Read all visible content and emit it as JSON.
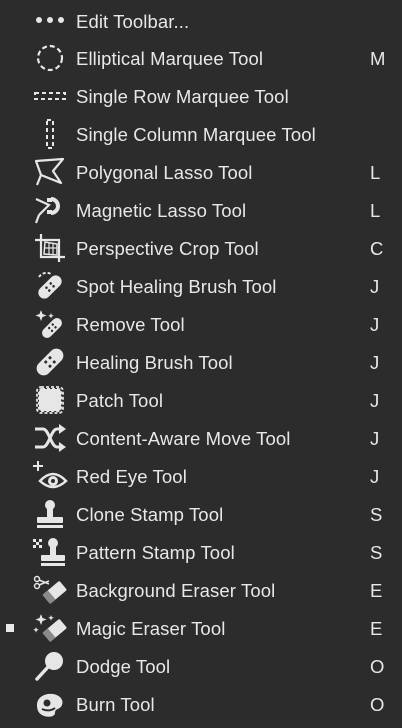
{
  "menu": {
    "items": [
      {
        "label": "Edit Toolbar...",
        "shortcut": "",
        "icon": "more-dots-icon",
        "selected": false
      },
      {
        "label": "Elliptical Marquee Tool",
        "shortcut": "M",
        "icon": "elliptical-marquee-icon",
        "selected": false
      },
      {
        "label": "Single Row Marquee Tool",
        "shortcut": "",
        "icon": "single-row-marquee-icon",
        "selected": false
      },
      {
        "label": "Single Column Marquee Tool",
        "shortcut": "",
        "icon": "single-column-marquee-icon",
        "selected": false
      },
      {
        "label": "Polygonal Lasso Tool",
        "shortcut": "L",
        "icon": "polygonal-lasso-icon",
        "selected": false
      },
      {
        "label": "Magnetic Lasso Tool",
        "shortcut": "L",
        "icon": "magnetic-lasso-icon",
        "selected": false
      },
      {
        "label": "Perspective Crop Tool",
        "shortcut": "C",
        "icon": "perspective-crop-icon",
        "selected": false
      },
      {
        "label": "Spot Healing Brush Tool",
        "shortcut": "J",
        "icon": "spot-healing-brush-icon",
        "selected": false
      },
      {
        "label": "Remove Tool",
        "shortcut": "J",
        "icon": "remove-tool-icon",
        "selected": false
      },
      {
        "label": "Healing Brush Tool",
        "shortcut": "J",
        "icon": "healing-brush-icon",
        "selected": false
      },
      {
        "label": "Patch Tool",
        "shortcut": "J",
        "icon": "patch-tool-icon",
        "selected": false
      },
      {
        "label": "Content-Aware Move Tool",
        "shortcut": "J",
        "icon": "content-aware-move-icon",
        "selected": false
      },
      {
        "label": "Red Eye Tool",
        "shortcut": "J",
        "icon": "red-eye-icon",
        "selected": false
      },
      {
        "label": "Clone Stamp Tool",
        "shortcut": "S",
        "icon": "clone-stamp-icon",
        "selected": false
      },
      {
        "label": "Pattern Stamp Tool",
        "shortcut": "S",
        "icon": "pattern-stamp-icon",
        "selected": false
      },
      {
        "label": "Background Eraser Tool",
        "shortcut": "E",
        "icon": "background-eraser-icon",
        "selected": false
      },
      {
        "label": "Magic Eraser Tool",
        "shortcut": "E",
        "icon": "magic-eraser-icon",
        "selected": true
      },
      {
        "label": "Dodge Tool",
        "shortcut": "O",
        "icon": "dodge-tool-icon",
        "selected": false
      },
      {
        "label": "Burn Tool",
        "shortcut": "O",
        "icon": "burn-tool-icon",
        "selected": false
      }
    ]
  }
}
